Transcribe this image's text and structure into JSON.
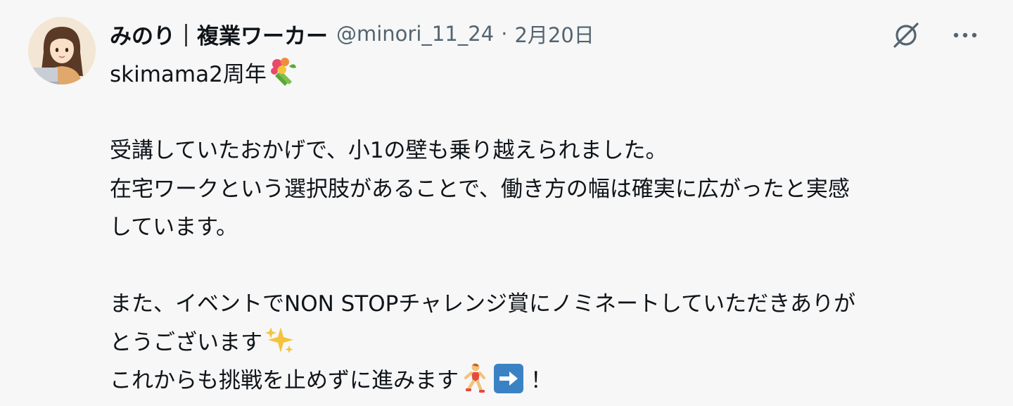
{
  "post": {
    "author": {
      "display_name": "みのり｜複業ワーカー",
      "handle": "@minori_11_24",
      "separator": "·",
      "date": "2月20日"
    },
    "lines": {
      "l1": "skimama2周年",
      "l3": "受講していたおかげで、小1の壁も乗り越えられました。",
      "l4": "在宅ワークという選択肢があることで、働き方の幅は確実に広がったと実感",
      "l5": "しています。",
      "l7": "また、イベントでNON STOPチャレンジ賞にノミネートしていただきありが",
      "l8": "とうございます",
      "l9": "これからも挑戦を止めずに進みます",
      "l9_end": "！"
    },
    "icons": {
      "unlinked": "unlinked-icon",
      "more": "more-icon",
      "bouquet": "bouquet-emoji",
      "sparkles": "sparkles-emoji",
      "runner": "runner-emoji",
      "arrow": "right-arrow-emoji"
    },
    "colors": {
      "background": "#f7f7f7",
      "text": "#0f1419",
      "muted": "#536471"
    }
  }
}
